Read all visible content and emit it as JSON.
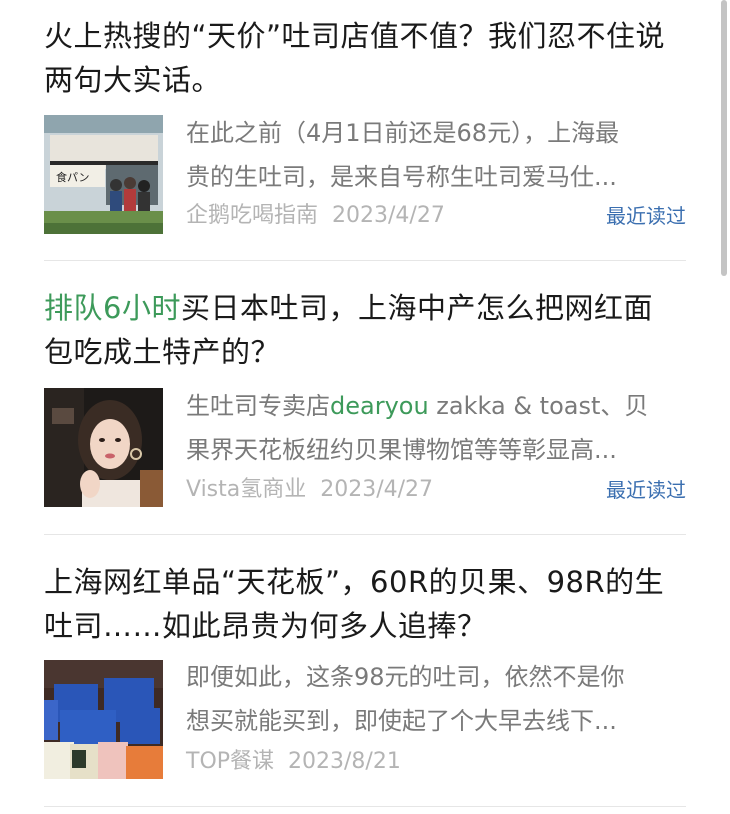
{
  "articles": [
    {
      "title_prefix": "",
      "title_line1": "火上热搜的“天价”吐司店值不值？我们忍不住说",
      "title_line2": "两句大实话。",
      "excerpt_line1_a": "在此之前（4月1日前还是68元），上海最",
      "excerpt_line1_hl": "",
      "excerpt_line1_b": "",
      "excerpt_line2": "贵的生吐司，是来自号称生吐司爱马仕...",
      "source": "企鹅吃喝指南",
      "date": "2023/4/27",
      "recent_label": "最近读过"
    },
    {
      "title_prefix": "排队6小时",
      "title_line1": "买日本吐司，上海中产怎么把网红面",
      "title_line2": "包吃成土特产的？",
      "excerpt_line1_a": "生吐司专卖店",
      "excerpt_line1_hl": "dearyou",
      "excerpt_line1_b": " zakka & toast、贝",
      "excerpt_line2": "果界天花板纽约贝果博物馆等等彰显高...",
      "source": "Vista氢商业",
      "date": "2023/4/27",
      "recent_label": "最近读过"
    },
    {
      "title_prefix": "",
      "title_line1": "上海网红单品“天花板”，60R的贝果、98R的生",
      "title_line2": "吐司……如此昂贵为何多人追捧？",
      "excerpt_line1_a": "即便如此，这条98元的吐司，依然不是你",
      "excerpt_line1_hl": "",
      "excerpt_line1_b": "",
      "excerpt_line2": "想买就能买到，即使起了个大早去线下...",
      "source": "TOP餐谋",
      "date": "2023/8/21",
      "recent_label": ""
    }
  ]
}
